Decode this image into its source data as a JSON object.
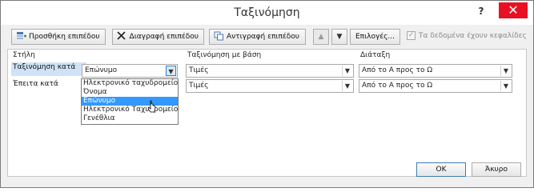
{
  "window": {
    "title": "Ταξινόμηση",
    "help": "?",
    "close": "✕"
  },
  "toolbar": {
    "add_level": "Προσθήκη επιπέδου",
    "delete_level": "Διαγραφή επιπέδου",
    "copy_level": "Αντιγραφή επιπέδου",
    "move_up": "▲",
    "move_down": "▼",
    "options": "Επιλογές...",
    "headers_label": "Τα δεδομένα έχουν κεφαλίδες",
    "headers_checked": true
  },
  "grid": {
    "columns": [
      "Στήλη",
      "Ταξινόμηση με βάση",
      "Διάταξη"
    ],
    "rows": [
      {
        "label": "Ταξινόμηση κατά",
        "column": "Επώνυμο",
        "sort_on": "Τιμές",
        "order": "Από το Α προς το Ω"
      },
      {
        "label": "Έπειτα κατά",
        "column": "",
        "sort_on": "Τιμές",
        "order": "Από το Α προς το Ω"
      }
    ]
  },
  "dropdown": {
    "options": [
      "Ηλεκτρονικό ταχυδρομείο",
      "Όνομα",
      "Επώνυμο",
      "Ηλεκτρονικό Ταχυδρομείο",
      "Γενέθλια"
    ],
    "selected_index": 2
  },
  "footer": {
    "ok": "OK",
    "cancel": "Άκυρο"
  },
  "colors": {
    "close_bg": "#e81123",
    "selection": "#3399ff",
    "row_highlight": "#cfe3f7"
  }
}
